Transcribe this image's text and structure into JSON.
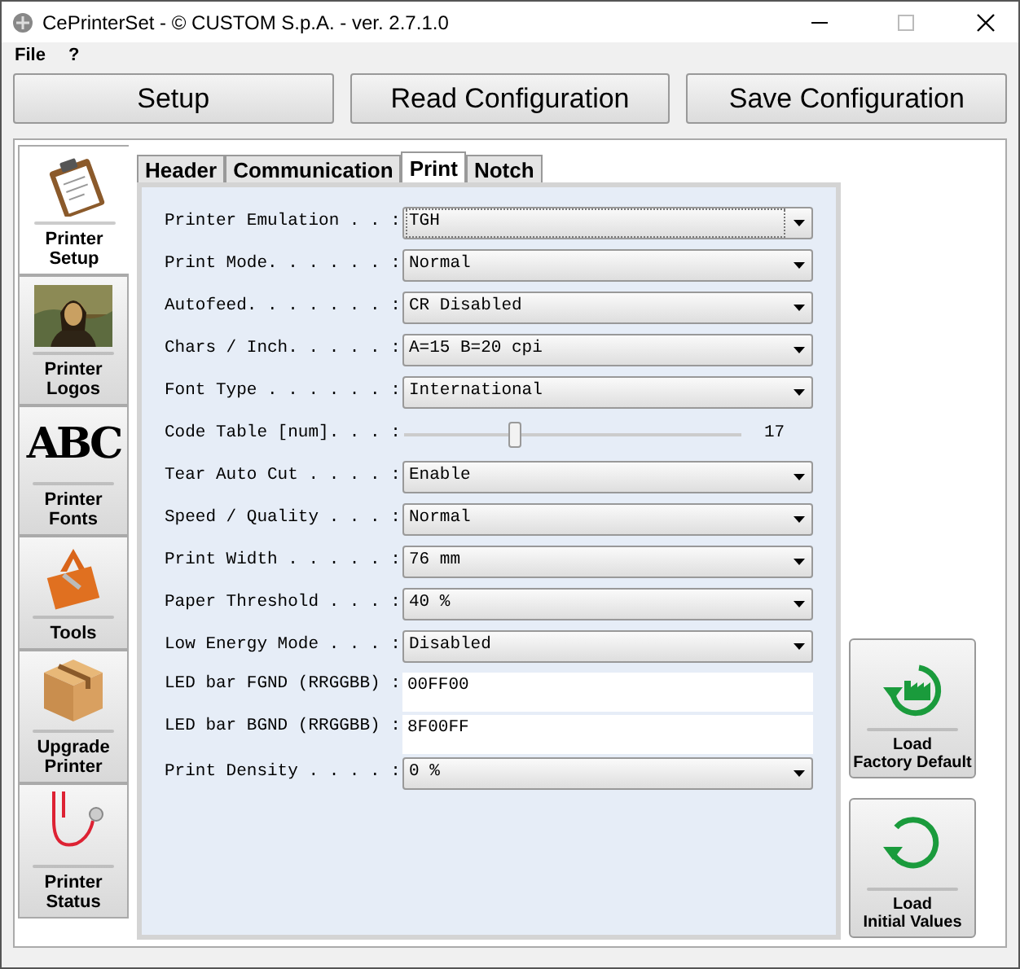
{
  "window": {
    "title": "CePrinterSet - © CUSTOM S.p.A. - ver. 2.7.1.0"
  },
  "menu": [
    "File",
    "?"
  ],
  "toolbar": [
    "Setup",
    "Read Configuration",
    "Save Configuration"
  ],
  "sidebar": {
    "items": [
      {
        "kind": "clipboard",
        "label": "Printer\nSetup",
        "selected": true
      },
      {
        "kind": "picture",
        "label": "Printer\nLogos",
        "selected": false
      },
      {
        "kind": "letters",
        "icon_text": "ABC",
        "label": "Printer\nFonts",
        "selected": false
      },
      {
        "kind": "toolbox",
        "label": "Tools",
        "selected": false
      },
      {
        "kind": "parcel",
        "label": "Upgrade\nPrinter",
        "selected": false
      },
      {
        "kind": "stethoscope",
        "label": "Printer\nStatus",
        "selected": false
      }
    ]
  },
  "tabs": [
    {
      "label": "Header",
      "selected": false
    },
    {
      "label": "Communication",
      "selected": false
    },
    {
      "label": "Print",
      "selected": true
    },
    {
      "label": "Notch",
      "selected": false
    }
  ],
  "settings": [
    {
      "kind": "select",
      "label": "Printer Emulation . . :",
      "value": "TGH",
      "focused": true
    },
    {
      "kind": "select",
      "label": "Print Mode. . . . . . :",
      "value": "Normal",
      "focused": false
    },
    {
      "kind": "select",
      "label": "Autofeed. . . . . . . :",
      "value": "CR Disabled",
      "focused": false
    },
    {
      "kind": "select",
      "label": "Chars / Inch. . . . . :",
      "value": "A=15 B=20 cpi",
      "focused": false
    },
    {
      "kind": "select",
      "label": "Font Type . . . . . . :",
      "value": "International",
      "focused": false
    },
    {
      "kind": "slider",
      "label": "Code Table [num]. . . :",
      "level": 0.33,
      "reading": "17"
    },
    {
      "kind": "select",
      "label": "Tear Auto Cut . . . . :",
      "value": "Enable",
      "focused": false
    },
    {
      "kind": "select",
      "label": "Speed / Quality . . . :",
      "value": "Normal",
      "focused": false
    },
    {
      "kind": "select",
      "label": "Print Width . . . . . :",
      "value": "76 mm",
      "focused": false
    },
    {
      "kind": "select",
      "label": "Paper Threshold . . . :",
      "value": "40 %",
      "focused": false
    },
    {
      "kind": "select",
      "label": "Low Energy Mode . . . :",
      "value": "Disabled",
      "focused": false
    },
    {
      "kind": "text",
      "label": "LED bar FGND (RRGGBB) :",
      "value": "00FF00"
    },
    {
      "kind": "text",
      "label": "LED bar BGND (RRGGBB) :",
      "value": "8F00FF"
    },
    {
      "kind": "select",
      "label": "Print Density . . . . :",
      "value": "0 %",
      "focused": false
    }
  ],
  "actions": [
    {
      "kind": "factory",
      "label": "Load\nFactory Default"
    },
    {
      "kind": "reset",
      "label": "Load\nInitial Values"
    }
  ]
}
